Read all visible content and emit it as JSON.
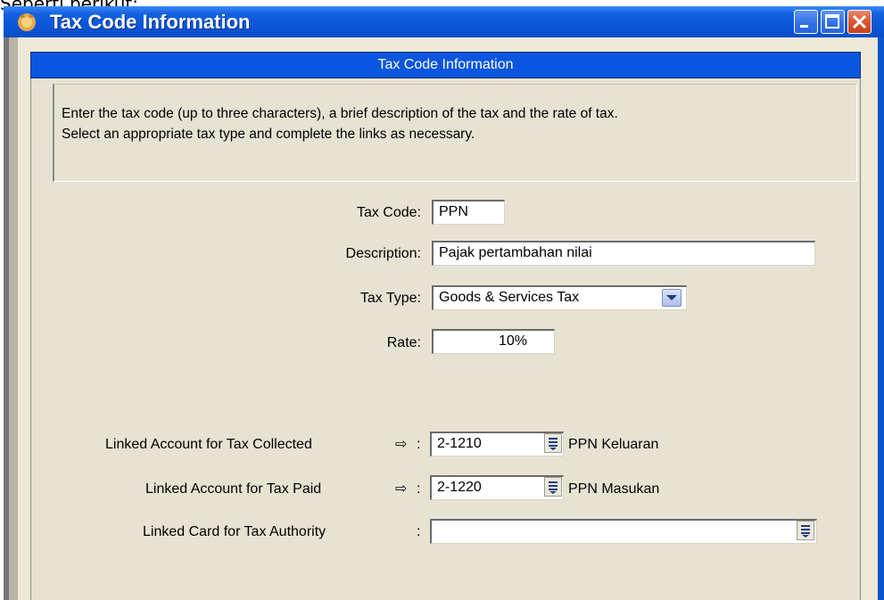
{
  "top_clipped_text": "Seperti berikut:",
  "window": {
    "title": "Tax Code Information",
    "controls": [
      "minimize",
      "maximize",
      "close"
    ]
  },
  "header": {
    "title": "Tax Code Information"
  },
  "instructions": {
    "line1": "Enter the tax code (up to three characters), a brief description of the tax and the rate of tax.",
    "line2": "Select an appropriate tax type and complete the links as necessary."
  },
  "form": {
    "tax_code": {
      "label": "Tax Code:",
      "value": "PPN"
    },
    "description": {
      "label": "Description:",
      "value": "Pajak pertambahan nilai"
    },
    "tax_type": {
      "label": "Tax Type:",
      "value": "Goods & Services Tax"
    },
    "rate": {
      "label": "Rate:",
      "value": "10%"
    }
  },
  "links": {
    "collected": {
      "label": "Linked Account for Tax Collected",
      "arrow": "⇨",
      "colon": ":",
      "value": "2-1210",
      "account_name": "PPN Keluaran"
    },
    "paid": {
      "label": "Linked Account for Tax Paid",
      "arrow": "⇨",
      "colon": ":",
      "value": "2-1220",
      "account_name": "PPN Masukan"
    },
    "authority": {
      "label": "Linked Card for Tax Authority",
      "colon": ":",
      "value": ""
    }
  },
  "colors": {
    "title_bar": "#0a56d8",
    "client": "#ece9d8",
    "header_bar": "#0a56e0"
  },
  "icons": {
    "app": "app-icon",
    "dropdown": "chevron-down-icon",
    "list": "list-icon",
    "arrow": "arrow-right-icon"
  }
}
